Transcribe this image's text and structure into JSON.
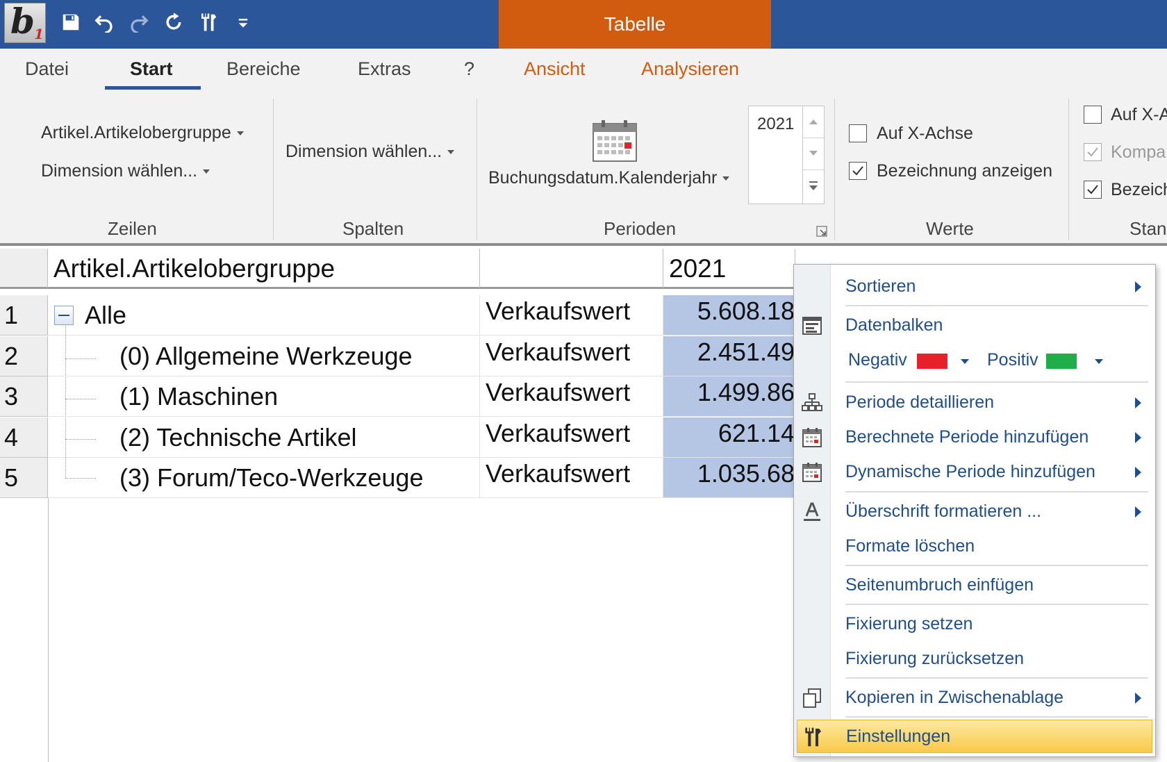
{
  "app": {
    "logo_text": "b",
    "logo_sub": "1",
    "context_tab": "Tabelle"
  },
  "qat": {
    "icons": [
      "save-icon",
      "undo-icon",
      "redo-icon",
      "refresh-icon",
      "tools-icon",
      "customize-icon"
    ]
  },
  "tabs": [
    "Datei",
    "Start",
    "Bereiche",
    "Extras",
    "?",
    "Ansicht",
    "Analysieren"
  ],
  "ribbon": {
    "zeilen": {
      "dim1": "Artikel.Artikelobergruppe",
      "dim2": "Dimension wählen...",
      "group": "Zeilen"
    },
    "spalten": {
      "dim": "Dimension wählen...",
      "group": "Spalten"
    },
    "perioden": {
      "dim": "Buchungsdatum.Kalenderjahr",
      "year": "2021",
      "group": "Perioden"
    },
    "werte": {
      "chk1": "Auf X-Achse",
      "chk2": "Bezeichnung anzeigen",
      "group": "Werte"
    },
    "standard": {
      "chk1": "Auf X-A",
      "chk2": "Kompa",
      "chk3": "Bezeich",
      "group": "Stan"
    }
  },
  "grid": {
    "headers": [
      "Artikel.Artikelobergruppe",
      "",
      "2021"
    ],
    "rows": [
      {
        "num": "1",
        "label": "Alle",
        "measure": "Verkaufswert",
        "value": "5.608.18"
      },
      {
        "num": "2",
        "label": "(0) Allgemeine Werkzeuge",
        "measure": "Verkaufswert",
        "value": "2.451.49"
      },
      {
        "num": "3",
        "label": "(1) Maschinen",
        "measure": "Verkaufswert",
        "value": "1.499.86"
      },
      {
        "num": "4",
        "label": "(2) Technische Artikel",
        "measure": "Verkaufswert",
        "value": "621.14"
      },
      {
        "num": "5",
        "label": "(3) Forum/Teco-Werkzeuge",
        "measure": "Verkaufswert",
        "value": "1.035.68"
      }
    ]
  },
  "context_menu": {
    "sortieren": "Sortieren",
    "datenbalken": "Datenbalken",
    "negativ": "Negativ",
    "positiv": "Positiv",
    "negativ_color": "#e8202a",
    "positiv_color": "#1fae4a",
    "periode_detaillieren": "Periode detaillieren",
    "berechnete_periode": "Berechnete Periode hinzufügen",
    "dynamische_periode": "Dynamische Periode hinzufügen",
    "ueberschrift": "Überschrift formatieren ...",
    "formate_loeschen": "Formate löschen",
    "seitenumbruch": "Seitenumbruch einfügen",
    "fixierung_setzen": "Fixierung setzen",
    "fixierung_zuruecksetzen": "Fixierung zurücksetzen",
    "kopieren": "Kopieren in Zwischenablage",
    "einstellungen": "Einstellungen"
  },
  "colors": {
    "titlebar": "#2b579a",
    "context_tab": "#d15b0f",
    "menu_text": "#1f4e8a",
    "value_cell": "#b4c6e4",
    "highlight": "#f8c94a"
  }
}
